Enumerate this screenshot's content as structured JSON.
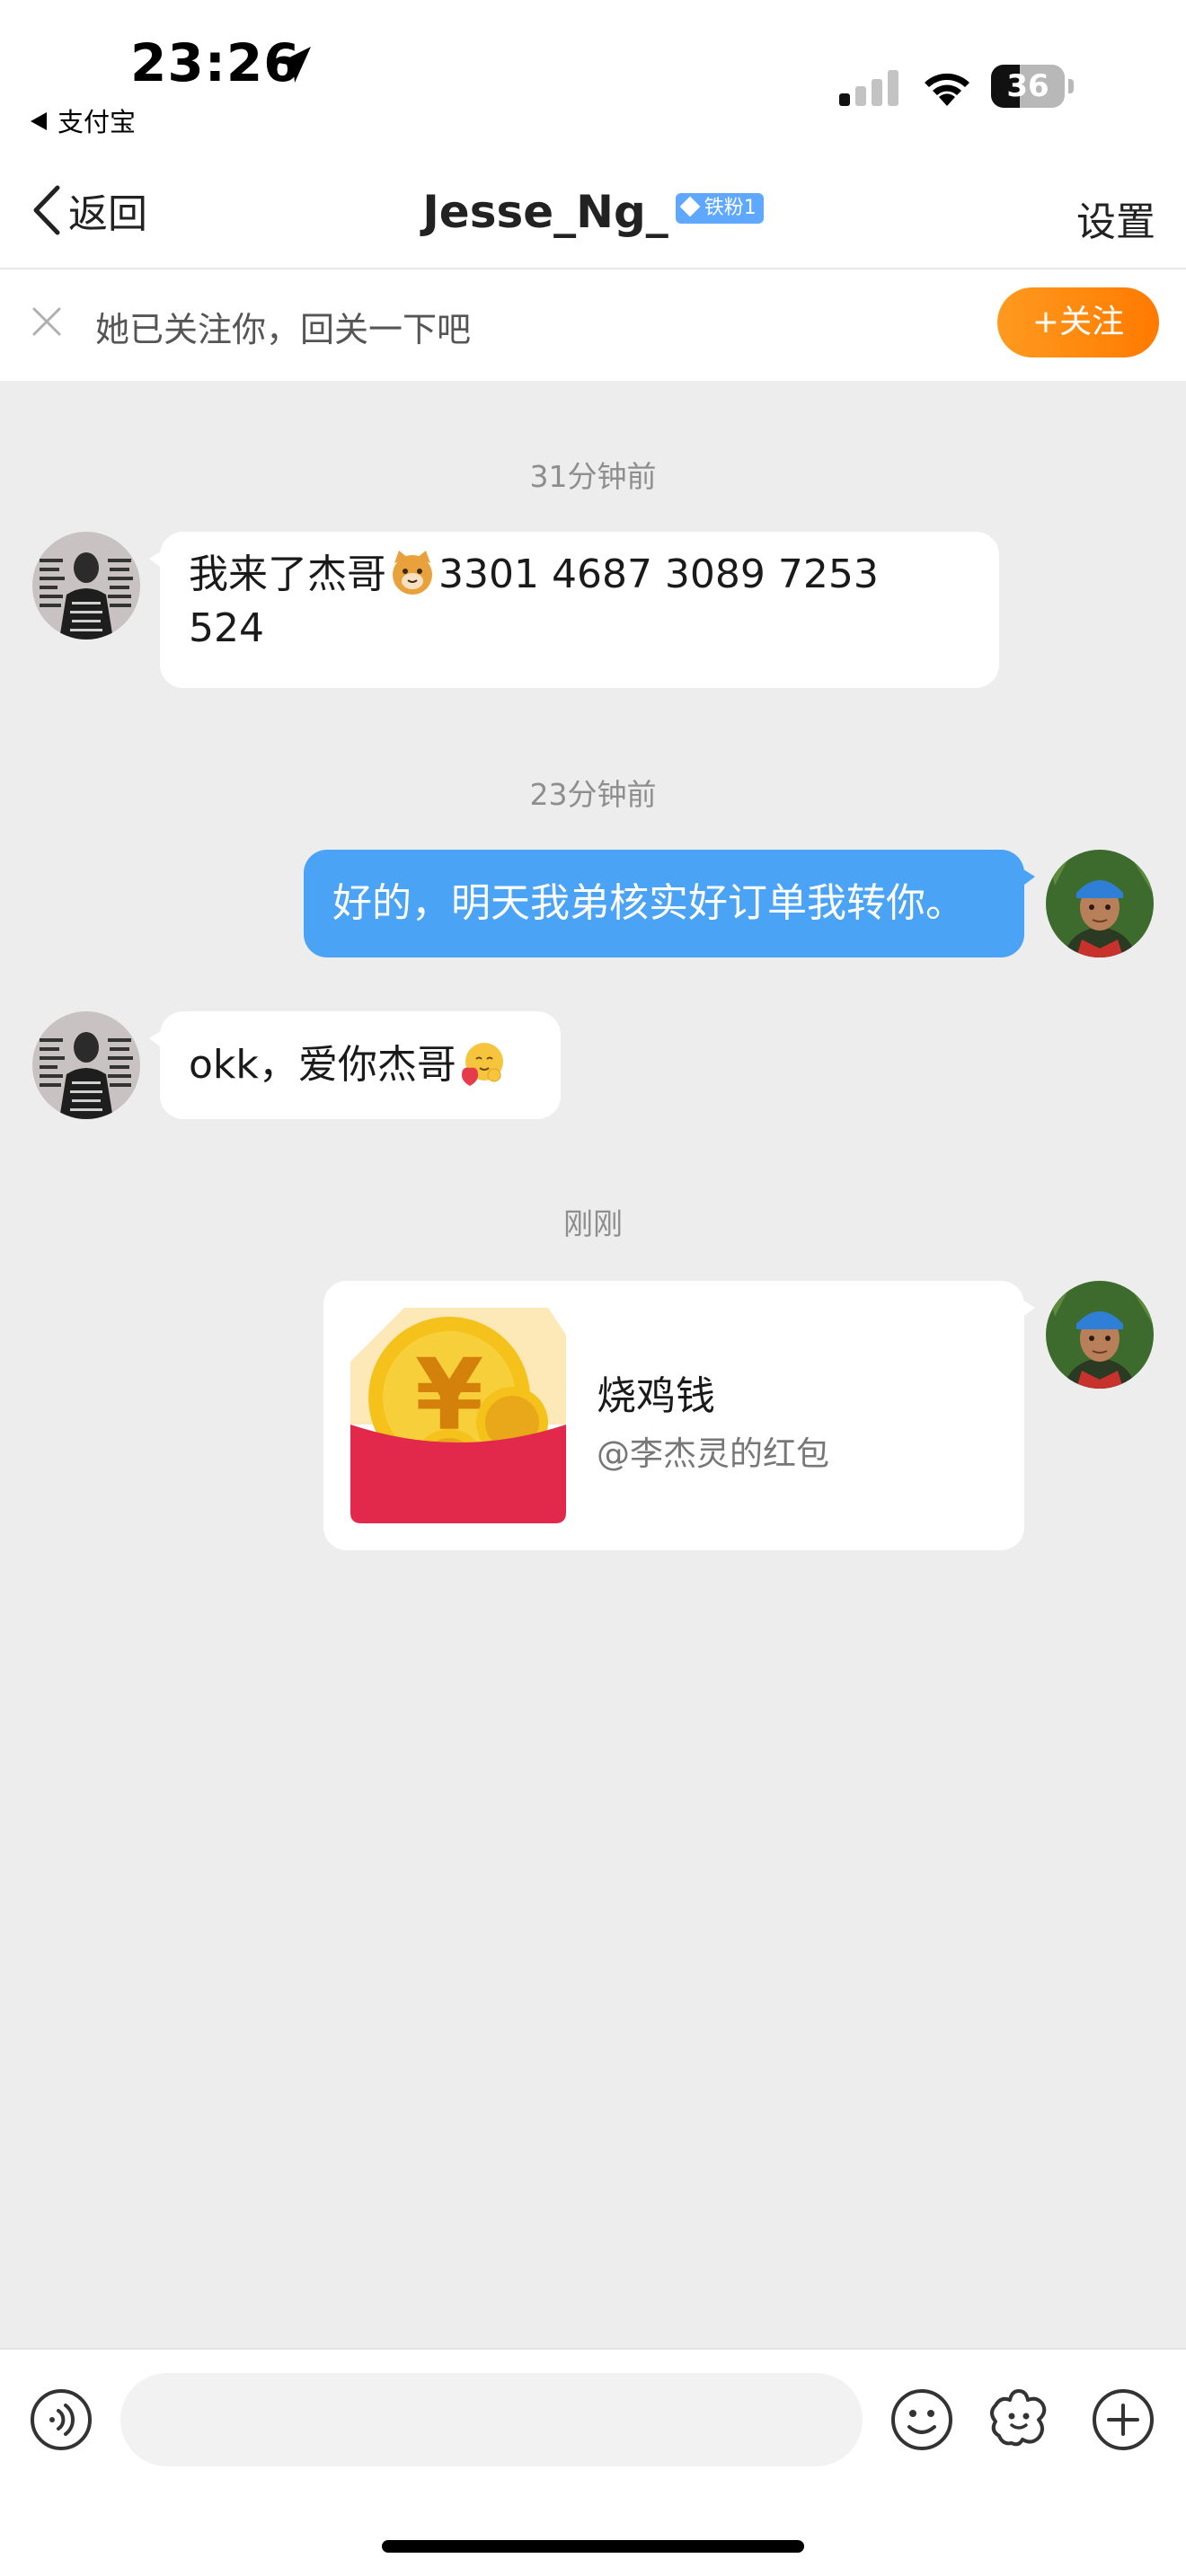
{
  "status_bar": {
    "time": "23:26",
    "back_app_label": "支付宝",
    "battery_level": "36"
  },
  "nav": {
    "back_label": "返回",
    "title": "Jesse_Ng_",
    "fan_badge": "铁粉1",
    "settings_label": "设置"
  },
  "follow_bar": {
    "text": "她已关注你，回关一下吧",
    "button_label": "+关注"
  },
  "messages": {
    "ts1": "31分钟前",
    "m1_text_a": "我来了杰哥",
    "m1_text_b": "3301 4687 3089 7253",
    "m1_text_c": "524",
    "ts2": "23分钟前",
    "m2_text": "好的，明天我弟核实好订单我转你。",
    "m3_text": "okk，爱你杰哥",
    "ts3": "刚刚",
    "red_packet": {
      "title": "烧鸡钱",
      "subtitle": "@李杰灵的红包",
      "yuan_symbol": "¥"
    }
  },
  "input": {
    "placeholder": ""
  },
  "colors": {
    "accent_blue": "#4aa3f5",
    "follow_orange": "#ff8a0d",
    "red_packet": "#e2294b",
    "coin_gold": "#f5c21b"
  }
}
